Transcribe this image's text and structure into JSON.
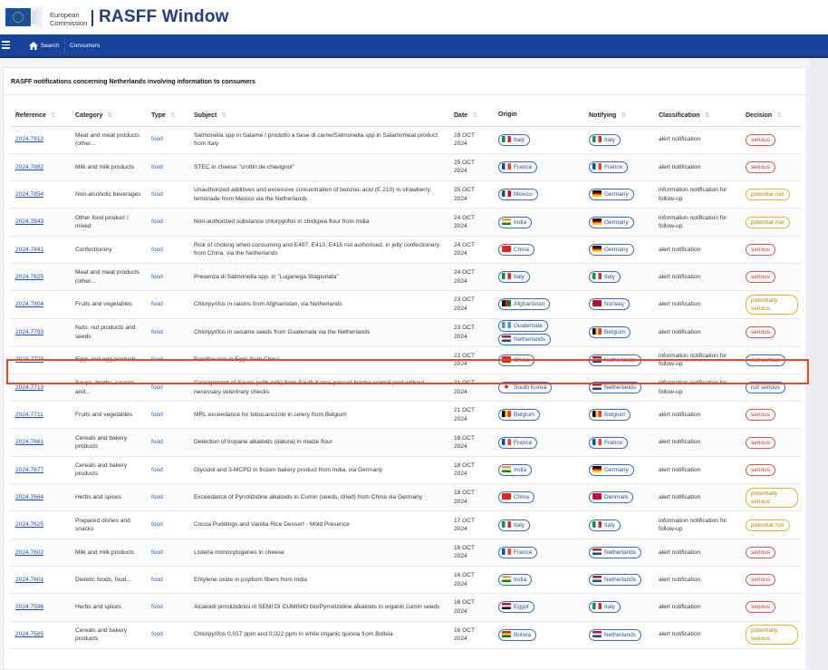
{
  "header": {
    "eu_line1": "European",
    "eu_line2": "Commission",
    "app_title": "RASFF Window"
  },
  "nav": {
    "search": "Search",
    "consumers": "Consumers"
  },
  "panel_title": "RASFF notifications concerning Netherlands involving information to consumers",
  "columns": [
    "Reference",
    "Category",
    "Type",
    "Subject",
    "Date",
    "Origin",
    "Notifying",
    "Classification",
    "Decision"
  ],
  "flag_colors": {
    "Italy": "linear-gradient(90deg,#009246 33%,#fff 33%,#fff 66%,#ce2b37 66%)",
    "France": "linear-gradient(90deg,#0055a4 33%,#fff 33%,#fff 66%,#ef4135 66%)",
    "Mexico": "linear-gradient(90deg,#006847 33%,#fff 33%,#fff 66%,#ce1126 66%)",
    "Germany": "linear-gradient(180deg,#000 33%,#dd0000 33%,#dd0000 66%,#ffce00 66%)",
    "India": "linear-gradient(180deg,#ff9933 33%,#fff 33%,#fff 66%,#138808 66%)",
    "China": "#de2910",
    "Afghanistan": "linear-gradient(90deg,#000 33%,#d32011 33%,#d32011 66%,#007a36 66%)",
    "Norway": "#ba0c2f",
    "Guatemala": "linear-gradient(90deg,#4997d0 33%,#fff 33%,#fff 66%,#4997d0 66%)",
    "Netherlands": "linear-gradient(180deg,#ae1c28 33%,#fff 33%,#fff 66%,#21468b 66%)",
    "Belgium": "linear-gradient(90deg,#000 33%,#fdda24 33%,#fdda24 66%,#ef3340 66%)",
    "South Korea": "radial-gradient(circle,#cd2e3a 30%,#fff 32%)",
    "Denmark": "#c8102e",
    "Egypt": "linear-gradient(180deg,#ce1126 33%,#fff 33%,#fff 66%,#000 66%)",
    "Bolivia": "linear-gradient(180deg,#d52b1e 33%,#f9e300 33%,#f9e300 66%,#007934 66%)"
  },
  "rows": [
    {
      "reference": "2024.7912",
      "category": "Meat and meat products (other...",
      "type": "food",
      "subject": "Salmonella spp in Salame / prodotto a base di carne/Salmonella spp in Salami/meat product from Italy",
      "date": "28 OCT 2024",
      "origin": [
        "Italy"
      ],
      "notifying": "Italy",
      "classification": "alert notification",
      "decision": "serious",
      "decision_kind": "serious"
    },
    {
      "reference": "2024.7882",
      "category": "Milk and milk products",
      "type": "food",
      "subject": "STEC in cheese \"crottin de chavignol\"",
      "date": "25 OCT 2024",
      "origin": [
        "France"
      ],
      "notifying": "France",
      "classification": "alert notification",
      "decision": "serious",
      "decision_kind": "serious"
    },
    {
      "reference": "2024.7854",
      "category": "Non-alcoholic beverages",
      "type": "food",
      "subject": "Unauthorized additives and excessive concentration of benzoic acid (E 210) in strawberry lemonade from Mexico via the Netherlands",
      "date": "25 OCT 2024",
      "origin": [
        "Mexico"
      ],
      "notifying": "Germany",
      "classification": "information notification for follow-up",
      "decision": "potential risk",
      "decision_kind": "warn"
    },
    {
      "reference": "2024.7843",
      "category": "Other food product / mixed",
      "type": "food",
      "subject": "Non-authorized substance chlorpyrifos in chickpea flour from India",
      "date": "24 OCT 2024",
      "origin": [
        "India"
      ],
      "notifying": "Germany",
      "classification": "information notification for follow-up",
      "decision": "potential risk",
      "decision_kind": "warn"
    },
    {
      "reference": "2024.7841",
      "category": "Confectionery",
      "type": "food",
      "subject": "Risk of choking when consuming and E407, E410, E415 not authorised, in jelly confectionery from China, via the Netherlands",
      "date": "24 OCT 2024",
      "origin": [
        "China"
      ],
      "notifying": "Germany",
      "classification": "alert notification",
      "decision": "serious",
      "decision_kind": "serious"
    },
    {
      "reference": "2024.7825",
      "category": "Meat and meat products (other...",
      "type": "food",
      "subject": "Presenza di Salmonella spp. in \"Luganega Stagionata\"",
      "date": "24 OCT 2024",
      "origin": [
        "Italy"
      ],
      "notifying": "Italy",
      "classification": "alert notification",
      "decision": "serious",
      "decision_kind": "serious"
    },
    {
      "reference": "2024.7804",
      "category": "Fruits and vegetables",
      "type": "food",
      "subject": "Chlorpyrifos in raisins from Afghanistan, via Netherlands",
      "date": "23 OCT 2024",
      "origin": [
        "Afghanistan"
      ],
      "notifying": "Norway",
      "classification": "alert notification",
      "decision": "potentially serious",
      "decision_kind": "warn-multi"
    },
    {
      "reference": "2024.7793",
      "category": "Nuts, nut products and seeds",
      "type": "food",
      "subject": "Chlorpyrifos in sesame seeds from Guatemala via the Netherlands",
      "date": "23 OCT 2024",
      "origin": [
        "Guatemala",
        "Netherlands"
      ],
      "notifying": "Belgium",
      "classification": "alert notification",
      "decision": "serious",
      "decision_kind": "serious"
    },
    {
      "reference": "2024.7729",
      "category": "Eggs and egg products",
      "type": "food",
      "subject": "Enrofloxacin in Eggs from China",
      "date": "22 OCT 2024",
      "origin": [
        "China"
      ],
      "notifying": "Netherlands",
      "classification": "information notification for follow-up",
      "decision": "not serious",
      "decision_kind": "info"
    },
    {
      "reference": "2024.7713",
      "category": "Soups, broths, sauces and...",
      "type": "food",
      "subject": "Consignment of Sauce (with milk) from South Korea passed border control post without necessary veterinary checks",
      "date": "21 OCT 2024",
      "origin": [
        "South Korea"
      ],
      "notifying": "Netherlands",
      "classification": "information notification for follow-up",
      "decision": "not serious",
      "decision_kind": "info"
    },
    {
      "reference": "2024.7711",
      "category": "Fruits and vegetables",
      "type": "food",
      "subject": "MRL exceedance for tebucanozole in celery from Belgium",
      "date": "21 OCT 2024",
      "origin": [
        "Belgium"
      ],
      "notifying": "Belgium",
      "classification": "alert notification",
      "decision": "serious",
      "decision_kind": "serious"
    },
    {
      "reference": "2024.7681",
      "category": "Cereals and bakery products",
      "type": "food",
      "subject": "Detection of tropane alkaloids (datura) in maize flour",
      "date": "18 OCT 2024",
      "origin": [
        "France"
      ],
      "notifying": "France",
      "classification": "alert notification",
      "decision": "serious",
      "decision_kind": "serious"
    },
    {
      "reference": "2024.7677",
      "category": "Cereals and bakery products",
      "type": "food",
      "subject": "Glycidol and 3-MCPD in frozen bakery product from India, via Germany",
      "date": "18 OCT 2024",
      "origin": [
        "India"
      ],
      "notifying": "Germany",
      "classification": "alert notification",
      "decision": "serious",
      "decision_kind": "serious"
    },
    {
      "reference": "2024.7664",
      "category": "Herbs and spices",
      "type": "food",
      "subject": "Exceedance of Pyrrolizidine alkaloids in Cumin (seeds, dried) from China via Germany",
      "date": "18 OCT 2024",
      "origin": [
        "China"
      ],
      "notifying": "Denmark",
      "classification": "alert notification",
      "decision": "potentially serious",
      "decision_kind": "warn-multi"
    },
    {
      "reference": "2024.7625",
      "category": "Prepared dishes and snacks",
      "type": "food",
      "subject": "Cocoa Puddings and Vanilla Rice Dessert - Mold Presence",
      "date": "17 OCT 2024",
      "origin": [
        "Italy"
      ],
      "notifying": "Italy",
      "classification": "information notification for follow-up",
      "decision": "potential risk",
      "decision_kind": "warn"
    },
    {
      "reference": "2024.7602",
      "category": "Milk and milk products",
      "type": "food",
      "subject": "Listeria monocytogenes in cheese",
      "date": "16 OCT 2024",
      "origin": [
        "France"
      ],
      "notifying": "Netherlands",
      "classification": "alert notification",
      "decision": "serious",
      "decision_kind": "serious"
    },
    {
      "reference": "2024.7601",
      "category": "Dietetic foods, food...",
      "type": "food",
      "subject": "Ehtylene oxide in psyllium fibers from India",
      "date": "16 OCT 2024",
      "origin": [
        "India"
      ],
      "notifying": "Netherlands",
      "classification": "alert notification",
      "decision": "serious",
      "decision_kind": "serious"
    },
    {
      "reference": "2024.7596",
      "category": "Herbs and spices",
      "type": "food",
      "subject": "Alcaloidi pirrolizidinici in SEMI DI CUMINIO bio/Pyrrolizidine alkaloids in organic cumin seeds",
      "date": "16 OCT 2024",
      "origin": [
        "Egypt"
      ],
      "notifying": "Italy",
      "classification": "alert notification",
      "decision": "serious",
      "decision_kind": "serious"
    },
    {
      "reference": "2024.7585",
      "category": "Cereals and bakery products",
      "type": "food",
      "subject": "Chlorpyrifos 0,017 ppm and 0,022 ppm in white organic quinoa from Bolivia",
      "date": "16 OCT 2024",
      "origin": [
        "Bolivia"
      ],
      "notifying": "Netherlands",
      "classification": "alert notification",
      "decision": "potentially serious",
      "decision_kind": "warn-multi"
    }
  ]
}
